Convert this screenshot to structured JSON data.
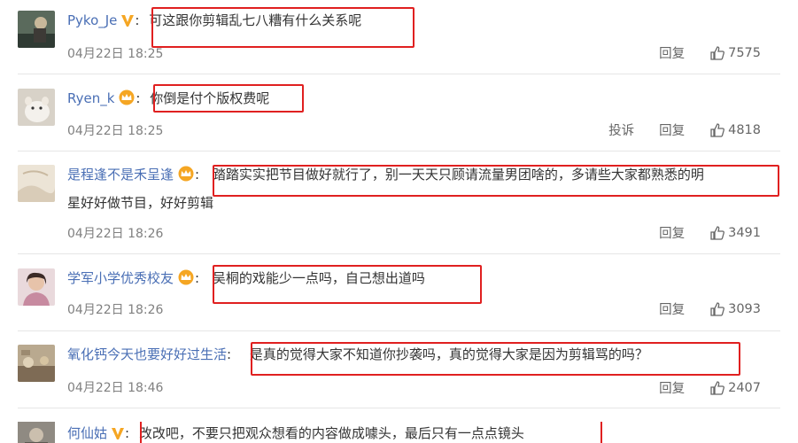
{
  "comments": [
    {
      "user": "Pyko_Je",
      "badge": "v",
      "text": "可这跟你剪辑乱七八糟有什么关系呢",
      "time": "04月22日 18:25",
      "report": "",
      "reply": "回复",
      "likes": "7575"
    },
    {
      "user": "Ryen_k",
      "badge": "crown",
      "text": "你倒是付个版权费呢",
      "time": "04月22日 18:25",
      "report": "投诉",
      "reply": "回复",
      "likes": "4818"
    },
    {
      "user": "是程逢不是禾呈逢",
      "badge": "crown",
      "text": "踏踏实实把节目做好就行了，别一天天只顾请流量男团啥的，多请些大家都熟悉的明",
      "text_cont": "星好好做节目，好好剪辑",
      "time": "04月22日 18:26",
      "report": "",
      "reply": "回复",
      "likes": "3491"
    },
    {
      "user": "学军小学优秀校友",
      "badge": "crown",
      "text": "吴桐的戏能少一点吗，自己想出道吗",
      "time": "04月22日 18:26",
      "report": "",
      "reply": "回复",
      "likes": "3093"
    },
    {
      "user": "氧化钙今天也要好好过生活",
      "badge": "",
      "text": "是真的觉得大家不知道你抄袭吗，真的觉得大家是因为剪辑骂的吗？",
      "time": "04月22日 18:46",
      "report": "",
      "reply": "回复",
      "likes": "2407"
    },
    {
      "user": "何仙姑",
      "badge": "v",
      "text": "改改吧，不要只把观众想看的内容做成噱头，最后只有一点点镜头",
      "time": "",
      "report": "",
      "reply": "",
      "likes": ""
    }
  ],
  "colors": {
    "username": "#4a6fb5",
    "highlight_box": "#e02020",
    "vip_badge": "#f5a623"
  }
}
